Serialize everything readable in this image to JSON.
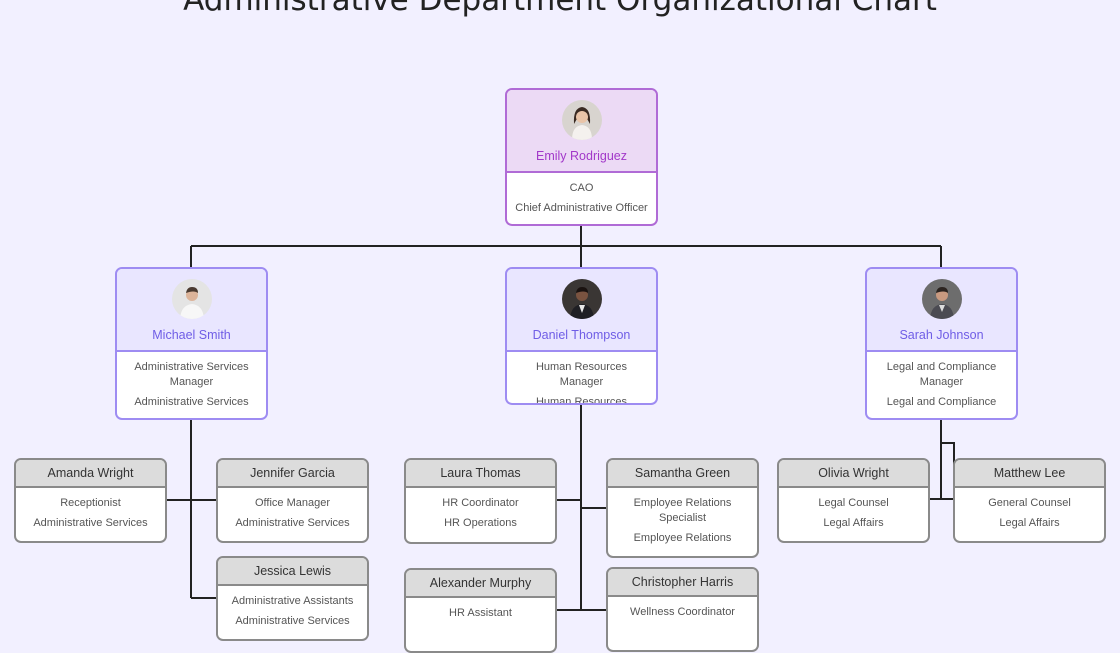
{
  "title": "Administrative Department Organizational Chart",
  "colors": {
    "background": "#f2f0ff",
    "executive_border": "#b06bd6",
    "manager_border": "#9e8cf2",
    "staff_border": "#8a8a8a",
    "connector": "#222222"
  },
  "executive": {
    "name": "Emily Rodriguez",
    "role": "CAO",
    "department": "Chief Administrative Officer",
    "icon": "avatar-photo"
  },
  "managers": [
    {
      "name": "Michael Smith",
      "role": "Administrative Services Manager",
      "department": "Administrative Services",
      "icon": "avatar-photo",
      "staff": [
        {
          "name": "Amanda Wright",
          "role": "Receptionist",
          "department": "Administrative Services"
        },
        {
          "name": "Jennifer Garcia",
          "role": "Office Manager",
          "department": "Administrative Services"
        },
        {
          "name": "Jessica Lewis",
          "role": "Administrative Assistants",
          "department": "Administrative Services"
        }
      ]
    },
    {
      "name": "Daniel Thompson",
      "role": "Human Resources Manager",
      "department": "Human Resources",
      "icon": "avatar-photo",
      "staff": [
        {
          "name": "Laura Thomas",
          "role": "HR Coordinator",
          "department": "HR Operations"
        },
        {
          "name": "Samantha Green",
          "role": "Employee Relations Specialist",
          "department": "Employee Relations"
        },
        {
          "name": "Alexander Murphy",
          "role": "HR Assistant",
          "department": ""
        },
        {
          "name": "Christopher Harris",
          "role": "Wellness Coordinator",
          "department": ""
        }
      ]
    },
    {
      "name": "Sarah Johnson",
      "role": "Legal and Compliance Manager",
      "department": "Legal and Compliance",
      "icon": "avatar-photo",
      "staff": [
        {
          "name": "Olivia Wright",
          "role": "Legal Counsel",
          "department": "Legal Affairs"
        },
        {
          "name": "Matthew Lee",
          "role": "General Counsel",
          "department": "Legal Affairs"
        }
      ]
    }
  ]
}
